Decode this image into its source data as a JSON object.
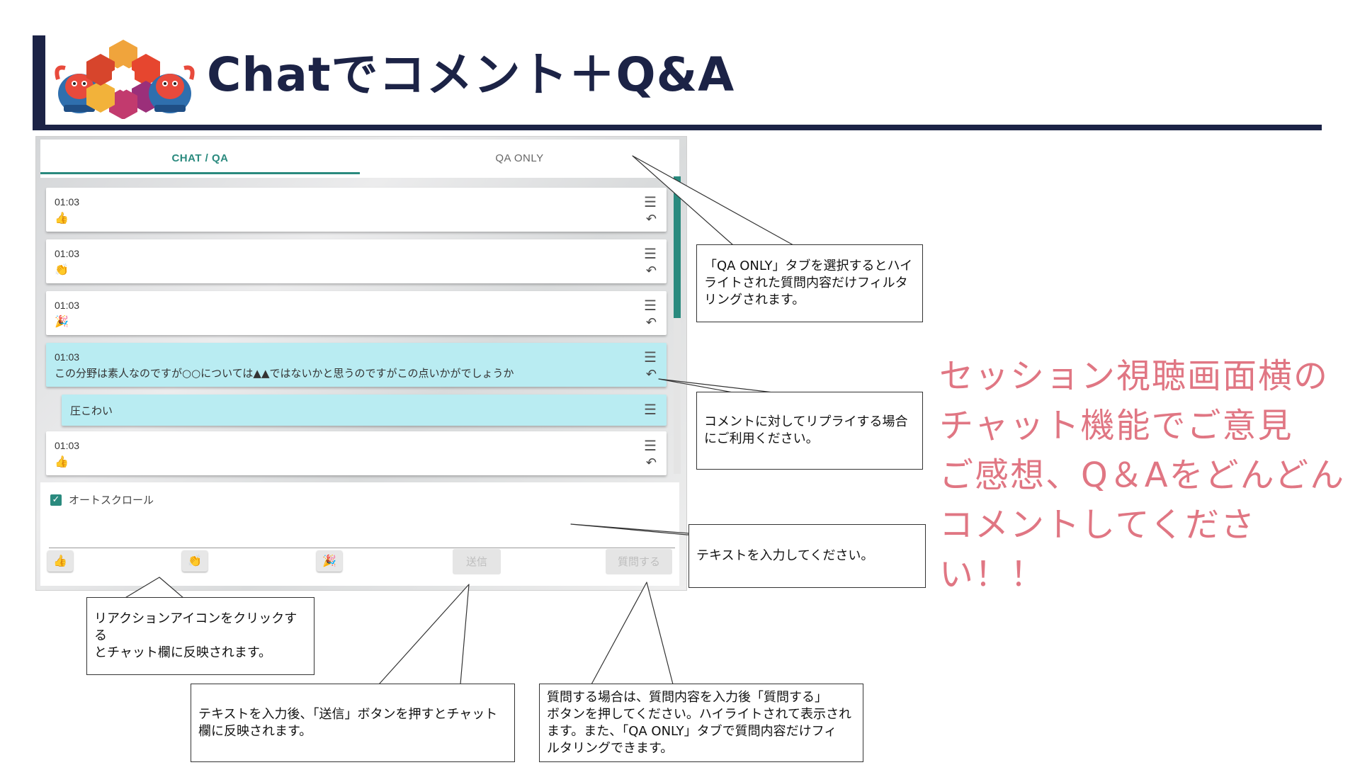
{
  "slide": {
    "title": "Chatでコメント＋Q&A",
    "side_text": "セッション視聴画面横の\nチャット機能でご意見\nご感想、Q＆Aをどんどん\nコメントしてください！！"
  },
  "chat_panel": {
    "tabs": [
      {
        "label": "CHAT / QA",
        "active": true
      },
      {
        "label": "QA ONLY",
        "active": false
      }
    ],
    "messages": [
      {
        "time": "01:03",
        "reaction": "thumbs-up-icon",
        "text": ""
      },
      {
        "time": "01:03",
        "reaction": "clap-icon",
        "text": ""
      },
      {
        "time": "01:03",
        "reaction": "party-popper-icon",
        "text": ""
      },
      {
        "time": "01:03",
        "reaction": "",
        "text": "この分野は素人なのですが○○については▲▲ではないかと思うのですがこの点いかがでしょうか",
        "highlighted": true
      },
      {
        "time": "",
        "reaction": "",
        "text": "圧こわい",
        "highlighted": true,
        "is_reply": true
      },
      {
        "time": "01:03",
        "reaction": "thumbs-up-icon",
        "text": ""
      }
    ],
    "autoscroll_label": "オートスクロール",
    "autoscroll_checked": true,
    "input_placeholder": "",
    "reaction_buttons": [
      "thumbs-up-icon",
      "clap-icon",
      "party-popper-icon"
    ],
    "send_label": "送信",
    "ask_label": "質問する",
    "accent_color": "#2a8a7e",
    "highlight_color": "#b9ecf2"
  },
  "annotations": {
    "qa_only": "「QA ONLY」タブを選択するとハイ\nライトされた質問内容だけフィルタ\nリングされます。",
    "reply": "コメントに対してリプライする場合\nにご利用ください。",
    "text_input": "テキストを入力してください。",
    "reaction": "リアクションアイコンをクリックする\nとチャット欄に反映されます。",
    "send": "テキストを入力後、「送信」ボタンを押すとチャット\n欄に反映されます。",
    "ask": "質問する場合は、質問内容を入力後「質問する」\nボタンを押してください。ハイライトされて表示され\nます。また、「QA ONLY」タブで質問内容だけフィ\nルタリングできます。"
  },
  "colors": {
    "title": "#1c2346",
    "side_text": "#e07683"
  }
}
